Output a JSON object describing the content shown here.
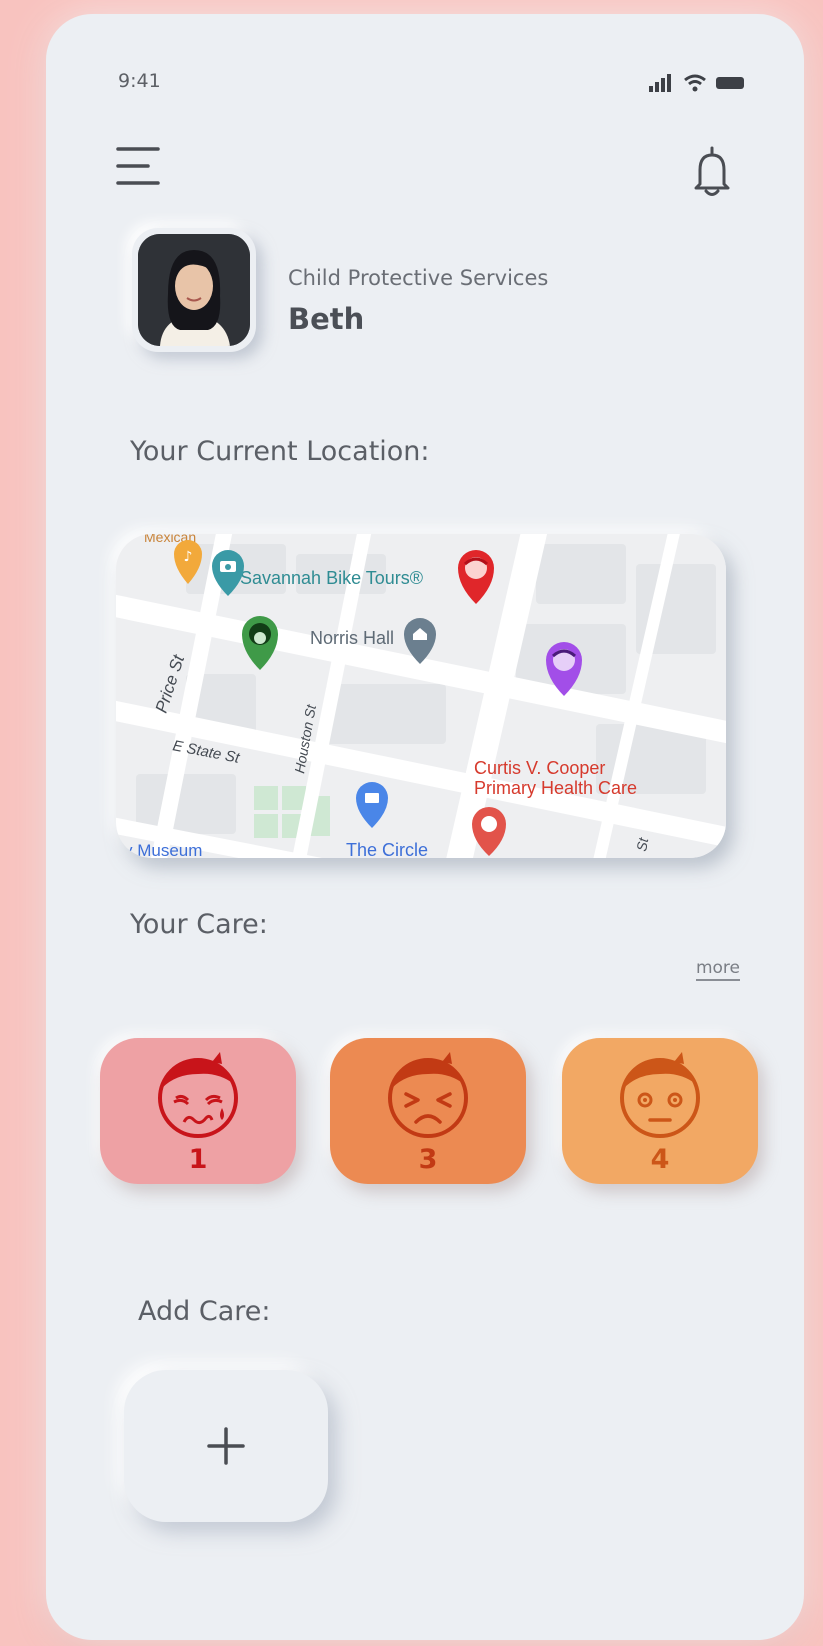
{
  "status_bar": {
    "time": "9:41"
  },
  "profile": {
    "organization": "Child Protective Services",
    "name": "Beth"
  },
  "location": {
    "label": "Your Current Location:",
    "map_labels": {
      "bike_tours": "Savannah Bike Tours®",
      "norris_hall": "Norris Hall",
      "price_st": "Price St",
      "houston_st": "Houston St",
      "e_state_st": "E State St",
      "health_care_line1": "Curtis V. Cooper",
      "health_care_line2": "Primary Health Care",
      "the_circle": "The Circle",
      "museum": "y Museum",
      "mexican": "Mexican",
      "st": "St"
    }
  },
  "care": {
    "label": "Your Care:",
    "more_label": "more",
    "items": [
      {
        "count": "1",
        "mood": "crying-face-icon",
        "bg": "#eea1a4",
        "color": "#c8141a"
      },
      {
        "count": "3",
        "mood": "distressed-face-icon",
        "bg": "#ec8a52",
        "color": "#c23a14"
      },
      {
        "count": "4",
        "mood": "neutral-face-icon",
        "bg": "#f2a864",
        "color": "#cc5618"
      }
    ]
  },
  "add_care": {
    "label": "Add Care:"
  },
  "icons": [
    "signal-icon",
    "wifi-icon",
    "battery-icon",
    "menu-icon",
    "bell-icon",
    "plus-icon"
  ]
}
